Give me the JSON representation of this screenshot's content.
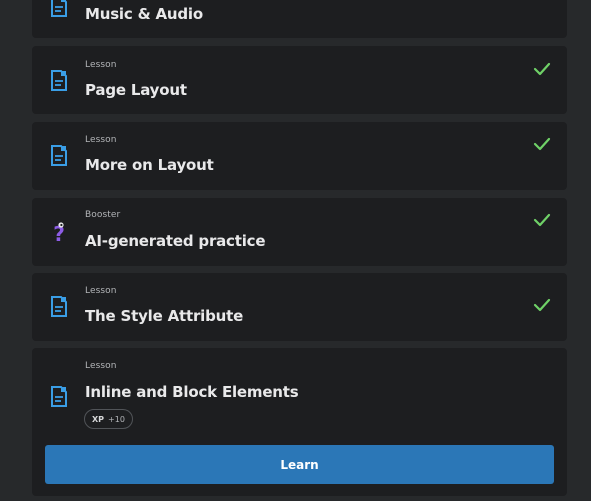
{
  "lessons": [
    {
      "type": "",
      "title": "Music & Audio",
      "icon": "lesson-doc-icon",
      "completed": false
    },
    {
      "type": "Lesson",
      "title": "Page Layout",
      "icon": "lesson-doc-icon",
      "completed": true
    },
    {
      "type": "Lesson",
      "title": "More on Layout",
      "icon": "lesson-doc-icon",
      "completed": true
    },
    {
      "type": "Booster",
      "title": "AI-generated practice",
      "icon": "question-mark-icon",
      "completed": true
    },
    {
      "type": "Lesson",
      "title": "The Style Attribute",
      "icon": "lesson-doc-icon",
      "completed": true
    },
    {
      "type": "Lesson",
      "title": "Inline and Block Elements",
      "icon": "lesson-doc-icon",
      "completed": false,
      "xp_label": "XP",
      "xp_value": "+10",
      "button_label": "Learn"
    }
  ],
  "colors": {
    "background": "#27292b",
    "card": "#1d1e20",
    "accent_blue": "#2b77b7",
    "lesson_icon": "#3a9ee6",
    "check_green": "#6fd167",
    "booster_purple": "#8d5ce6"
  }
}
